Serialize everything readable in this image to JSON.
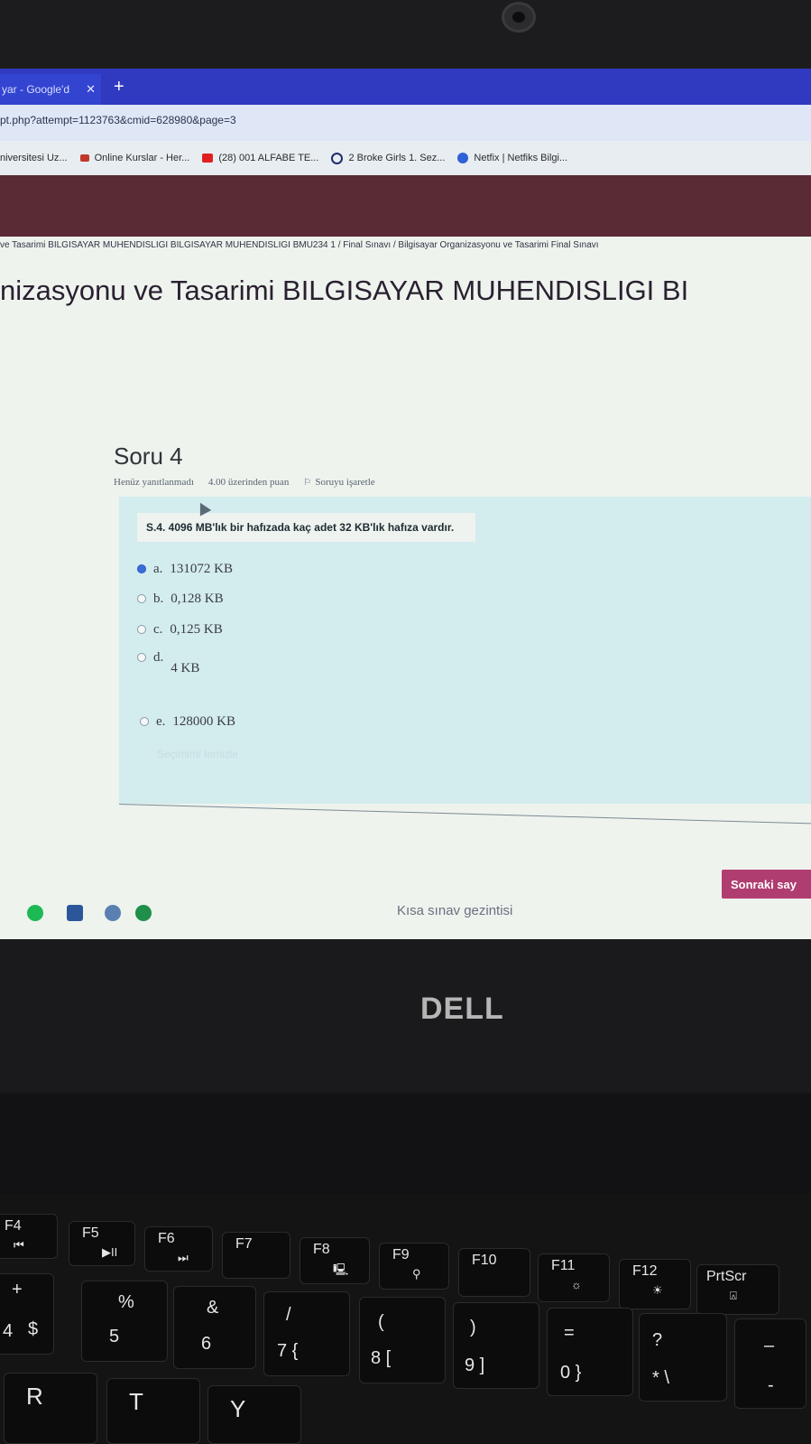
{
  "browser": {
    "tab_title": "yar - Google'd",
    "tab_close": "✕",
    "new_tab": "+",
    "url": "pt.php?attempt=1123763&cmid=628980&page=3",
    "bookmarks": [
      {
        "label": "niversitesi Uz...",
        "icon_color": "#3b3b3b"
      },
      {
        "label": "Online Kurslar - Her...",
        "icon_color": "#c0392b"
      },
      {
        "label": "(28) 001 ALFABE TE...",
        "icon_color": "#e02020"
      },
      {
        "label": "2 Broke Girls 1. Sez...",
        "icon_color": "#1f2c6b"
      },
      {
        "label": "Netfix | Netfiks Bilgi...",
        "icon_color": "#3060d8"
      }
    ]
  },
  "page": {
    "breadcrumb": "ve Tasarimi BILGISAYAR MUHENDISLIGI BILGISAYAR MUHENDISLIGI BMU234 1  /  Final Sınavı  /  Bilgisayar Organizasyonu ve Tasarimi Final Sınavı",
    "course_title": "nizasyonu ve Tasarimi BILGISAYAR MUHENDISLIGI BI"
  },
  "question": {
    "heading": "Soru 4",
    "status": "Henüz yanıtlanmadı",
    "points": "4.00 üzerinden puan",
    "flag_label": "Soruyu işaretle",
    "text": "S.4. 4096 MB'lık bir hafızada kaç adet 32 KB'lık hafıza vardır.",
    "options": [
      {
        "letter": "a.",
        "value": "131072 KB",
        "selected": true
      },
      {
        "letter": "b.",
        "value": "0,128 KB",
        "selected": false
      },
      {
        "letter": "c.",
        "value": "0,125 KB",
        "selected": false
      },
      {
        "letter": "d.",
        "value": "4 KB",
        "selected": false
      },
      {
        "letter": "e.",
        "value": "128000 KB",
        "selected": false
      }
    ],
    "clear_choice": "Seçimimi temizle"
  },
  "navigation": {
    "next_button": "Sonraki say",
    "quiz_navigation": "Kısa sınav gezintisi"
  },
  "laptop": {
    "brand": "DELL"
  },
  "keyboard": {
    "function_row": [
      {
        "label": "F4",
        "symbol": "⏮"
      },
      {
        "label": "F5",
        "symbol": "▶II"
      },
      {
        "label": "F6",
        "symbol": "⏭"
      },
      {
        "label": "F7",
        "symbol": ""
      },
      {
        "label": "F8",
        "symbol": "🖳"
      },
      {
        "label": "F9",
        "symbol": "⚲"
      },
      {
        "label": "F10",
        "symbol": ""
      },
      {
        "label": "F11",
        "symbol": "☼"
      },
      {
        "label": "F12",
        "symbol": "☀"
      },
      {
        "label": "PrtScr",
        "symbol": "⍓"
      }
    ],
    "number_row": [
      {
        "top": "+",
        "bottom": ""
      },
      {
        "top": "$",
        "bottom": "4"
      },
      {
        "top": "%",
        "bottom": "5"
      },
      {
        "top": "&",
        "bottom": "6"
      },
      {
        "top": "/",
        "bottom": "7 {"
      },
      {
        "top": "(",
        "bottom": "8 ["
      },
      {
        "top": ")",
        "bottom": "9 ]"
      },
      {
        "top": "=",
        "bottom": "0 }"
      },
      {
        "top": "?",
        "bottom": "* \\"
      },
      {
        "top": "–",
        "bottom": "-"
      }
    ],
    "letter_row": [
      "R",
      "T",
      "Y"
    ]
  }
}
